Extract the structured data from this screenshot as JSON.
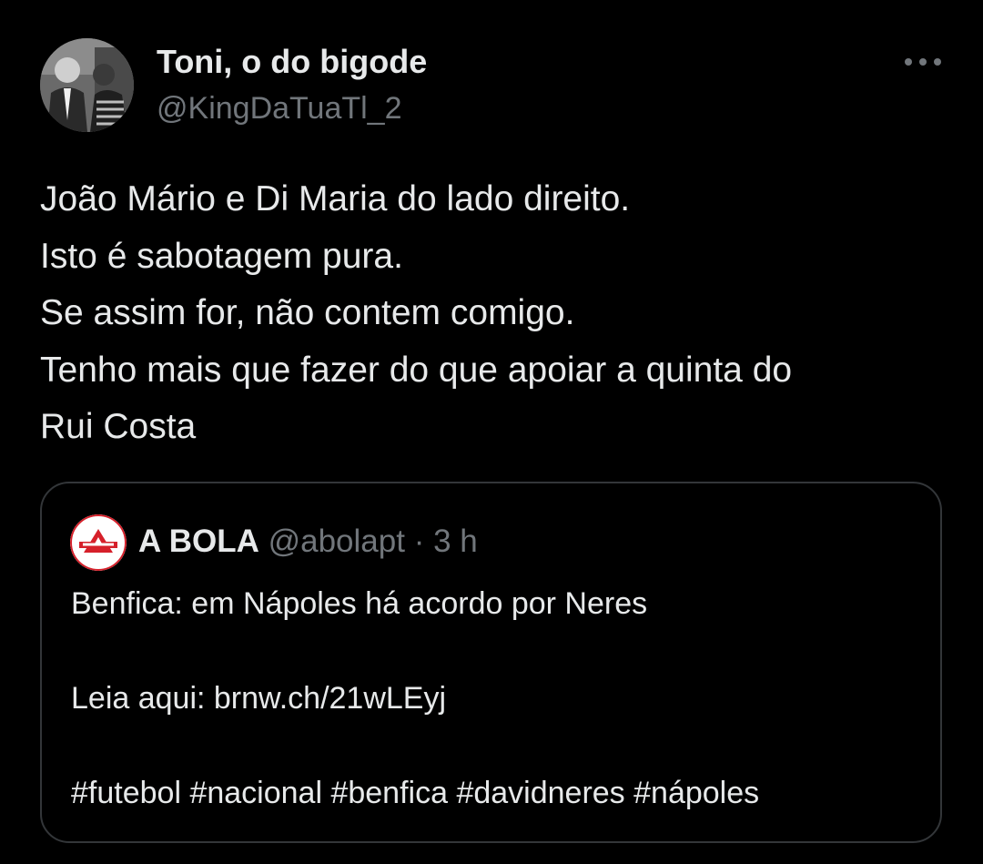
{
  "tweet": {
    "author": {
      "display_name": "Toni, o do bigode",
      "handle": "@KingDaTuaTl_2",
      "avatar_icon": "profile-photo"
    },
    "more_icon": "more-horizontal-icon",
    "text_lines": [
      "João Mário e Di Maria do lado direito.",
      "Isto é sabotagem pura.",
      "Se assim for, não contem comigo.",
      "Tenho mais que fazer do que apoiar a quinta do",
      "Rui Costa"
    ]
  },
  "quote": {
    "author": {
      "display_name": "A BOLA",
      "handle": "@abolapt",
      "separator": "·",
      "time": "3 h",
      "avatar_icon": "a-bola-logo"
    },
    "text_lines": [
      "Benfica: em Nápoles há acordo por Neres",
      "",
      "Leia aqui: brnw.ch/21wLEyj",
      "",
      "#futebol #nacional #benfica #davidneres #nápoles"
    ]
  },
  "colors": {
    "background": "#000000",
    "primary_text": "#e7e9ea",
    "secondary_text": "#71767b",
    "border": "#333639",
    "brand_red": "#d6202a"
  }
}
